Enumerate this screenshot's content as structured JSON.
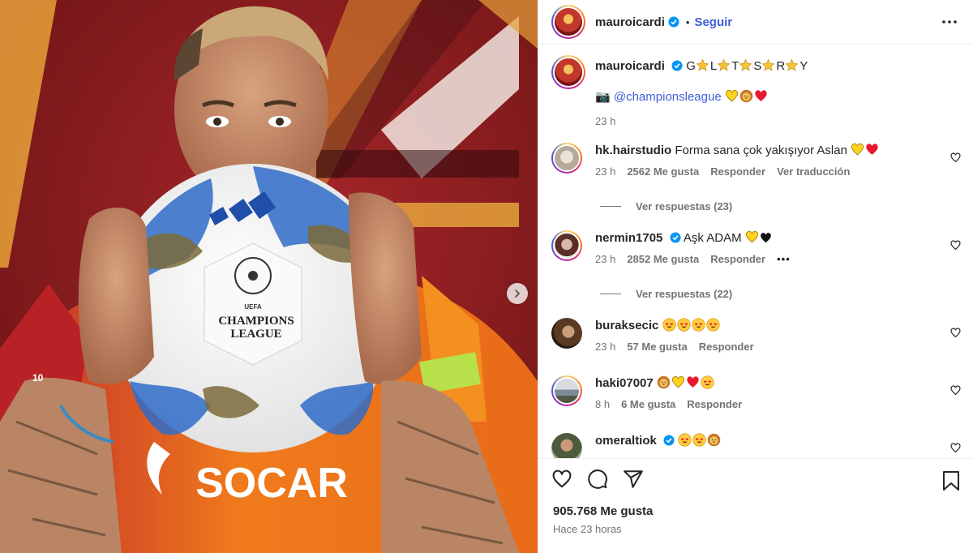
{
  "post": {
    "username": "mauroicardi",
    "follow_label": "Seguir",
    "separator": "•"
  },
  "caption": {
    "username": "mauroicardi",
    "title_letters": [
      "G",
      "L",
      "T",
      "S",
      "R",
      "Y"
    ],
    "camera_emoji": "📷",
    "mention": "@championsleague",
    "time": "23 h"
  },
  "comments": [
    {
      "username": "hk.hairstudio",
      "text": "Forma sana çok yakışıyor Aslan",
      "time": "23 h",
      "likes": "2562 Me gusta",
      "reply": "Responder",
      "translate": "Ver traducción",
      "replies": "Ver respuestas (23)"
    },
    {
      "username": "nermin1705",
      "text": "Aşk ADAM",
      "time": "23 h",
      "likes": "2852 Me gusta",
      "reply": "Responder",
      "options": "•••",
      "replies": "Ver respuestas (22)"
    },
    {
      "username": "buraksecic",
      "time": "23 h",
      "likes": "57 Me gusta",
      "reply": "Responder"
    },
    {
      "username": "haki07007",
      "time": "8 h",
      "likes": "6 Me gusta",
      "reply": "Responder"
    },
    {
      "username": "omeraltiok"
    }
  ],
  "footer": {
    "likes": "905.768 Me gusta",
    "time_ago": "Hace 23 horas"
  },
  "photo": {
    "ball_brand": "CHAMPIONS",
    "ball_brand2": "LEAGUE",
    "ball_uefa": "UEFA",
    "shirt_sponsor": "SOCAR",
    "sleeve_number": "10"
  },
  "icons": {
    "verified": "verified-badge-icon",
    "more": "more-horizontal-icon",
    "next": "chevron-right-icon",
    "like": "heart-outline-icon",
    "comment": "comment-bubble-icon",
    "share": "paper-plane-icon",
    "save": "bookmark-icon"
  },
  "colors": {
    "accent": "#3f5fd8",
    "verified": "#0095f6",
    "muted": "#737373",
    "background_red": "#8c1d1a",
    "jersey_orange": "#f07b1c"
  }
}
